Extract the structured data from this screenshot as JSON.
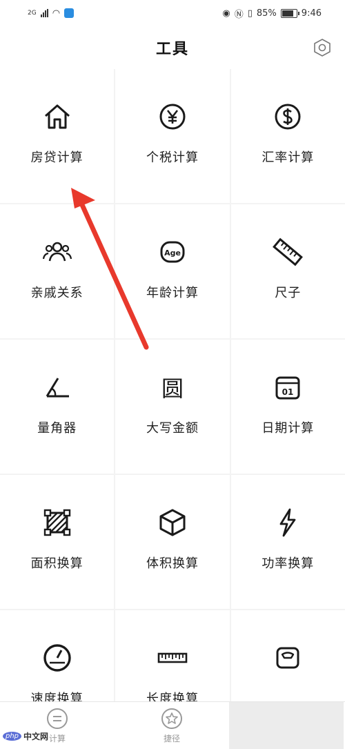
{
  "status_bar": {
    "net": "2G",
    "battery": "85%",
    "time": "9:46"
  },
  "header": {
    "title": "工具"
  },
  "tools": [
    {
      "label": "房贷计算",
      "icon": "house-icon"
    },
    {
      "label": "个税计算",
      "icon": "yen-coin-icon"
    },
    {
      "label": "汇率计算",
      "icon": "dollar-coin-icon"
    },
    {
      "label": "亲戚关系",
      "icon": "people-group-icon"
    },
    {
      "label": "年龄计算",
      "icon": "age-badge-icon",
      "icon_text": "Age"
    },
    {
      "label": "尺子",
      "icon": "ruler-icon"
    },
    {
      "label": "量角器",
      "icon": "protractor-angle-icon"
    },
    {
      "label": "大写金额",
      "icon": "yuan-character-icon",
      "icon_text": "圆"
    },
    {
      "label": "日期计算",
      "icon": "calendar-icon",
      "icon_text": "01"
    },
    {
      "label": "面积换算",
      "icon": "area-square-icon"
    },
    {
      "label": "体积换算",
      "icon": "cube-icon"
    },
    {
      "label": "功率换算",
      "icon": "lightning-icon"
    },
    {
      "label": "速度换算",
      "icon": "speedometer-icon"
    },
    {
      "label": "长度换算",
      "icon": "ruler-horizontal-icon"
    },
    {
      "label": "",
      "icon": "scale-icon"
    }
  ],
  "tabbar": [
    {
      "label": "计算",
      "icon": "equals-circle-icon"
    },
    {
      "label": "捷径",
      "icon": "star-circle-icon"
    },
    {
      "label": "",
      "icon": "blank"
    }
  ],
  "watermark": {
    "logo": "php",
    "text": "中文网"
  },
  "colors": {
    "arrow": "#e8392c",
    "icon": "#1a1a1a",
    "background": "#f6f6f6"
  }
}
